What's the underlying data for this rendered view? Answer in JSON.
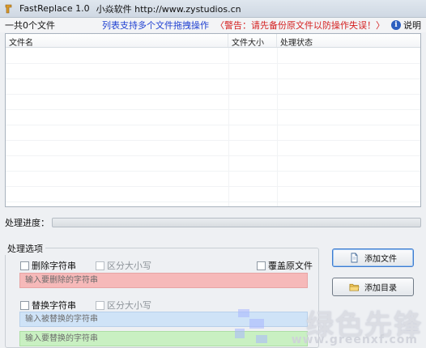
{
  "window": {
    "title": "FastReplace 1.0",
    "subtitle": "小焱软件 http://www.zystudios.cn"
  },
  "topbar": {
    "file_count": "一共0个文件",
    "drag_hint": "列表支持多个文件拖拽操作",
    "warning": "〈警告：请先备份原文件以防操作失误！〉",
    "help_label": "说明",
    "help_icon": "info-icon"
  },
  "file_table": {
    "columns": [
      "文件名",
      "文件大小",
      "处理状态"
    ],
    "rows": []
  },
  "progress": {
    "label": "处理进度：",
    "value": 0
  },
  "options": {
    "legend": "处理选项",
    "delete": {
      "label": "删除字符串",
      "checked": false,
      "case_label": "区分大小写",
      "case_checked": false,
      "placeholder": "输入要删除的字符串"
    },
    "overwrite": {
      "label": "覆盖原文件",
      "checked": false
    },
    "replace": {
      "label": "替换字符串",
      "checked": false,
      "case_label": "区分大小写",
      "case_checked": false,
      "find_placeholder": "输入被替换的字符串",
      "replace_placeholder": "输入要替换的字符串"
    }
  },
  "buttons": {
    "add_file": "添加文件",
    "add_folder": "添加目录"
  },
  "watermark": {
    "text": "绿色先锋",
    "sub": "www.greenxf.com"
  },
  "colors": {
    "delete_input_bg": "#f6b9b9",
    "find_input_bg": "#cfe3f7",
    "replace_input_bg": "#c9f0c2",
    "drag_hint": "#1e3fd1",
    "warning": "#d41f1f"
  }
}
